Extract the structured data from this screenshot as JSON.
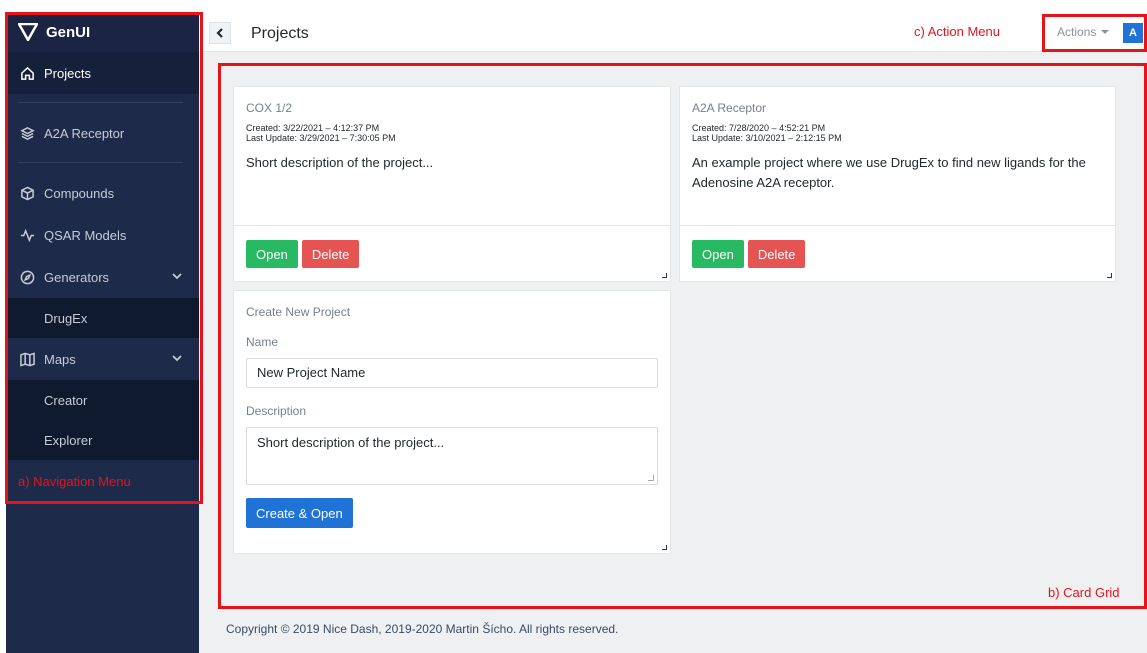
{
  "sidebar": {
    "brand": "GenUI",
    "items": [
      {
        "label": "Projects",
        "icon": "home-icon"
      },
      {
        "label": "A2A Receptor",
        "icon": "layers-icon"
      },
      {
        "label": "Compounds",
        "icon": "cube-icon"
      },
      {
        "label": "QSAR Models",
        "icon": "activity-icon"
      },
      {
        "label": "Generators",
        "icon": "compass-icon"
      },
      {
        "label": "DrugEx"
      },
      {
        "label": "Maps",
        "icon": "map-icon"
      },
      {
        "label": "Creator"
      },
      {
        "label": "Explorer"
      }
    ]
  },
  "header": {
    "title": "Projects",
    "actions_label": "Actions",
    "avatar_initial": "A"
  },
  "cards": [
    {
      "title": "COX 1/2",
      "created": "Created: 3/22/2021 – 4:12:37 PM",
      "updated": "Last Update: 3/29/2021 – 7:30:05 PM",
      "description": "Short description of the project...",
      "open_label": "Open",
      "delete_label": "Delete"
    },
    {
      "title": "A2A Receptor",
      "created": "Created: 7/28/2020 – 4:52:21 PM",
      "updated": "Last Update: 3/10/2021 – 2:12:15 PM",
      "description": "An example project where we use DrugEx to find new ligands for the Adenosine A2A receptor.",
      "open_label": "Open",
      "delete_label": "Delete"
    }
  ],
  "new_project": {
    "title": "Create New Project",
    "name_label": "Name",
    "name_value": "New Project Name",
    "description_label": "Description",
    "description_value": "Short description of the project...",
    "submit_label": "Create & Open"
  },
  "footer": {
    "copyright": "Copyright © 2019 Nice Dash, 2019-2020 Martin Šícho. All rights reserved."
  },
  "annotations": {
    "nav": "a) Navigation Menu",
    "grid": "b) Card Grid",
    "actions": "c) Action Menu",
    "color": "#e5141b"
  }
}
